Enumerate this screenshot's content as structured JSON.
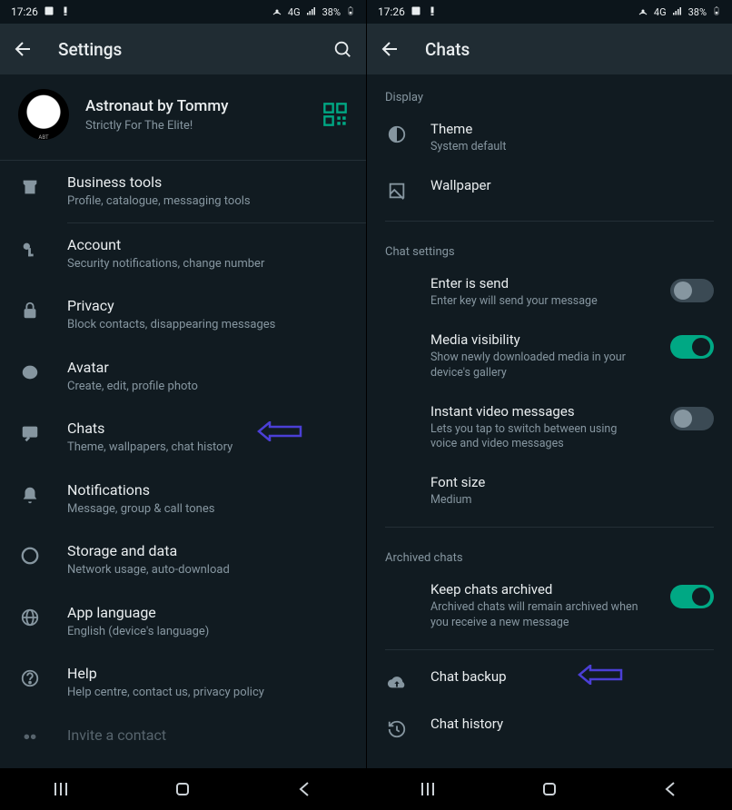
{
  "status": {
    "time": "17:26",
    "net": "4G",
    "battery": "38%"
  },
  "left": {
    "title": "Settings",
    "profile": {
      "name": "Astronaut by Tommy",
      "status": "Strictly For The Elite!"
    },
    "items": [
      {
        "t1": "Business tools",
        "t2": "Profile, catalogue, messaging tools"
      },
      {
        "t1": "Account",
        "t2": "Security notifications, change number"
      },
      {
        "t1": "Privacy",
        "t2": "Block contacts, disappearing messages"
      },
      {
        "t1": "Avatar",
        "t2": "Create, edit, profile photo"
      },
      {
        "t1": "Chats",
        "t2": "Theme, wallpapers, chat history"
      },
      {
        "t1": "Notifications",
        "t2": "Message, group & call tones"
      },
      {
        "t1": "Storage and data",
        "t2": "Network usage, auto-download"
      },
      {
        "t1": "App language",
        "t2": "English (device's language)"
      },
      {
        "t1": "Help",
        "t2": "Help centre, contact us, privacy policy"
      },
      {
        "t1": "Invite a contact",
        "t2": ""
      }
    ]
  },
  "right": {
    "title": "Chats",
    "sections": {
      "display": "Display",
      "chat_settings": "Chat settings",
      "archived": "Archived chats"
    },
    "theme": {
      "t1": "Theme",
      "t2": "System default"
    },
    "wallpaper": {
      "t1": "Wallpaper"
    },
    "enter_send": {
      "t1": "Enter is send",
      "t2": "Enter key will send your message"
    },
    "media_vis": {
      "t1": "Media visibility",
      "t2": "Show newly downloaded media in your device's gallery"
    },
    "instant_video": {
      "t1": "Instant video messages",
      "t2": "Lets you tap to switch between using voice and video messages"
    },
    "font_size": {
      "t1": "Font size",
      "t2": "Medium"
    },
    "keep_archived": {
      "t1": "Keep chats archived",
      "t2": "Archived chats will remain archived when you receive a new message"
    },
    "chat_backup": {
      "t1": "Chat backup"
    },
    "chat_history": {
      "t1": "Chat history"
    }
  }
}
